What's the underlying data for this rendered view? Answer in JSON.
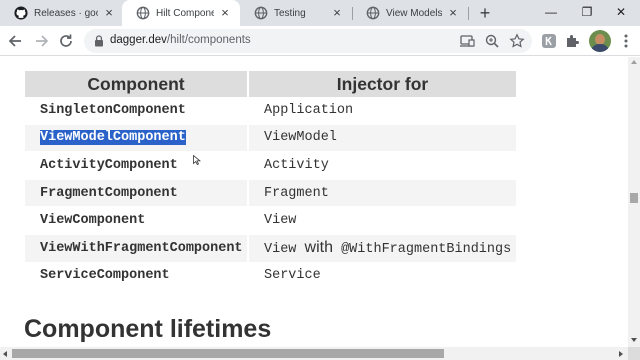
{
  "browser": {
    "tabs": [
      {
        "title": "Releases · google/dagger",
        "icon": "github-icon"
      },
      {
        "title": "Hilt Components",
        "icon": "globe-icon",
        "active": true
      },
      {
        "title": "Testing",
        "icon": "globe-icon"
      },
      {
        "title": "View Models",
        "icon": "globe-icon"
      }
    ],
    "close_glyph": "×",
    "new_tab_glyph": "+",
    "window_controls": {
      "minimize": "—",
      "restore": "❐",
      "close": "✕"
    },
    "url_host": "dagger.dev",
    "url_path": "/hilt/components"
  },
  "table": {
    "headers": [
      "Component",
      "Injector for"
    ],
    "rows": [
      {
        "component": "SingletonComponent",
        "injector_for": "Application"
      },
      {
        "component": "ViewModelComponent",
        "injector_for": "ViewModel",
        "selected": true
      },
      {
        "component": "ActivityComponent",
        "injector_for": "Activity"
      },
      {
        "component": "FragmentComponent",
        "injector_for": "Fragment"
      },
      {
        "component": "ViewComponent",
        "injector_for": "View"
      },
      {
        "component": "ViewWithFragmentComponent",
        "injector_for_parts": [
          "View",
          "with",
          "@WithFragmentBindings"
        ]
      },
      {
        "component": "ServiceComponent",
        "injector_for": "Service"
      }
    ]
  },
  "section_heading": "Component lifetimes",
  "colors": {
    "selection": "#2a62c9",
    "header_bg": "#dddddd",
    "tab_strip": "#dee1e6"
  }
}
